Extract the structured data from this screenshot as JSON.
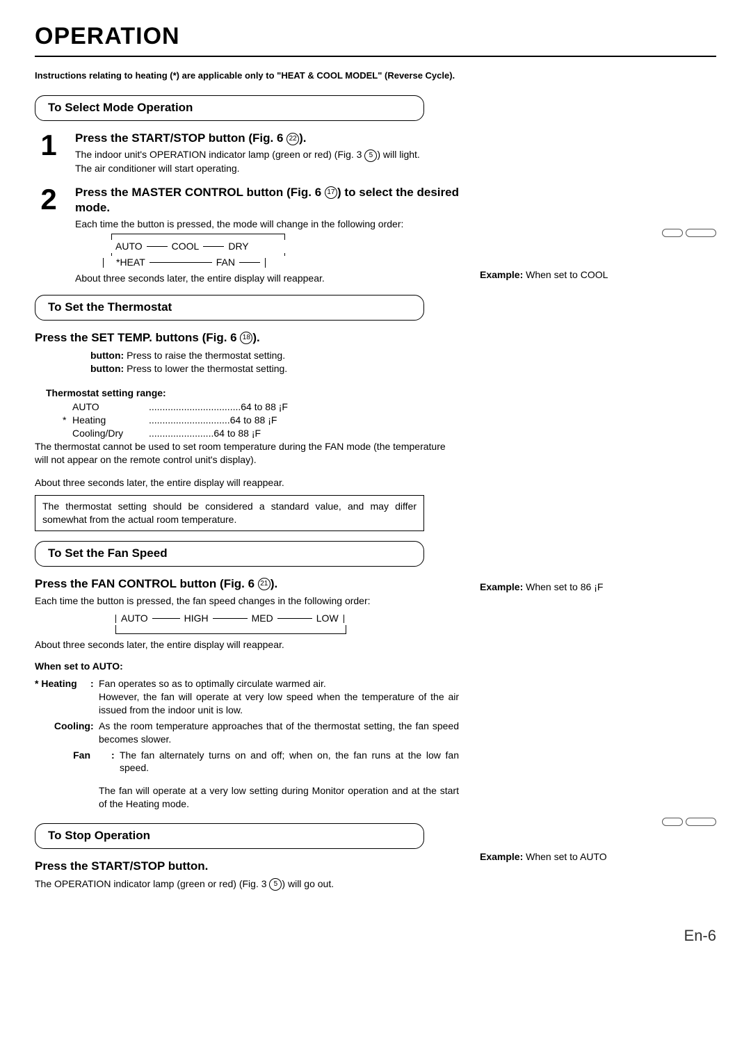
{
  "title": "OPERATION",
  "top_note": "Instructions relating to heating (*) are applicable only to \"HEAT & COOL MODEL\" (Reverse Cycle).",
  "page_number": "En-6",
  "sections": {
    "select_mode": {
      "header": "To Select Mode Operation",
      "step1": {
        "num": "1",
        "head_a": "Press the START/STOP button (Fig. 6 ",
        "head_circ": "22",
        "head_b": ").",
        "line1_a": "The indoor unit's OPERATION indicator lamp (green or red) (Fig. 3 ",
        "line1_circ": "5",
        "line1_b": ") will light.",
        "line2": "The air conditioner will start operating."
      },
      "step2": {
        "num": "2",
        "head_a": "Press the MASTER CONTROL button (Fig. 6 ",
        "head_circ": "17",
        "head_b": ") to select the desired mode.",
        "line1": "Each time the button is pressed, the mode will change in the following order:",
        "modes_row1": [
          "AUTO",
          "COOL",
          "DRY"
        ],
        "modes_row2": [
          "*HEAT",
          "FAN"
        ],
        "line2": "About three seconds later, the entire display will reappear."
      }
    },
    "thermostat": {
      "header": "To Set the Thermostat",
      "head_a": "Press the SET TEMP. buttons (Fig. 6 ",
      "head_circ": "18",
      "head_b": ").",
      "btn_up": "button:  Press to raise the thermostat setting.",
      "btn_dn": "button:  Press to lower the thermostat setting.",
      "range_title": "Thermostat setting range:",
      "ranges": [
        {
          "star": "",
          "label": "AUTO",
          "dots": "..................................",
          "val": "64 to 88 ¡F"
        },
        {
          "star": "*",
          "label": "Heating",
          "dots": "..............................",
          "val": "64 to 88 ¡F"
        },
        {
          "star": "",
          "label": "Cooling/Dry",
          "dots": "........................",
          "val": "64 to 88 ¡F"
        }
      ],
      "note1": "The thermostat cannot be used to set room temperature during the FAN mode (the temperature will not appear on the remote control unit's display).",
      "note2": "About three seconds later, the entire display will reappear.",
      "box": "The thermostat setting should be considered a standard value, and may differ somewhat from the actual room temperature."
    },
    "fan": {
      "header": "To Set the Fan Speed",
      "head_a": "Press the FAN CONTROL button (Fig. 6 ",
      "head_circ": "21",
      "head_b": ").",
      "line1": "Each time the button is pressed, the fan speed changes in the following order:",
      "speeds": [
        "AUTO",
        "HIGH",
        "MED",
        "LOW"
      ],
      "line2": "About three seconds later, the entire display will reappear.",
      "auto_title": "When set to AUTO:",
      "rows": [
        {
          "star": "* ",
          "label": "Heating",
          "text": "Fan operates so as to optimally circulate warmed air.\nHowever, the fan will operate at very low speed when the temperature of the air issued from the indoor unit is low."
        },
        {
          "star": "",
          "label": "Cooling",
          "text": "As the room temperature approaches that of the thermostat setting, the fan speed becomes slower."
        },
        {
          "star": "",
          "label": "Fan",
          "text": "The fan alternately turns on and off; when on, the fan runs at the low fan speed."
        }
      ],
      "tail": "The fan will operate at a very low setting during Monitor operation and at the start of the Heating mode."
    },
    "stop": {
      "header": "To Stop Operation",
      "head": "Press the START/STOP button.",
      "line_a": "The OPERATION indicator lamp (green or red) (Fig. 3 ",
      "line_circ": "5",
      "line_b": ") will go out."
    }
  },
  "right": {
    "ex1_label": "Example:",
    "ex1_text": " When set to COOL",
    "ex2_label": "Example:",
    "ex2_text": " When set to 86 ¡F",
    "ex3_label": "Example:",
    "ex3_text": " When set to AUTO"
  }
}
